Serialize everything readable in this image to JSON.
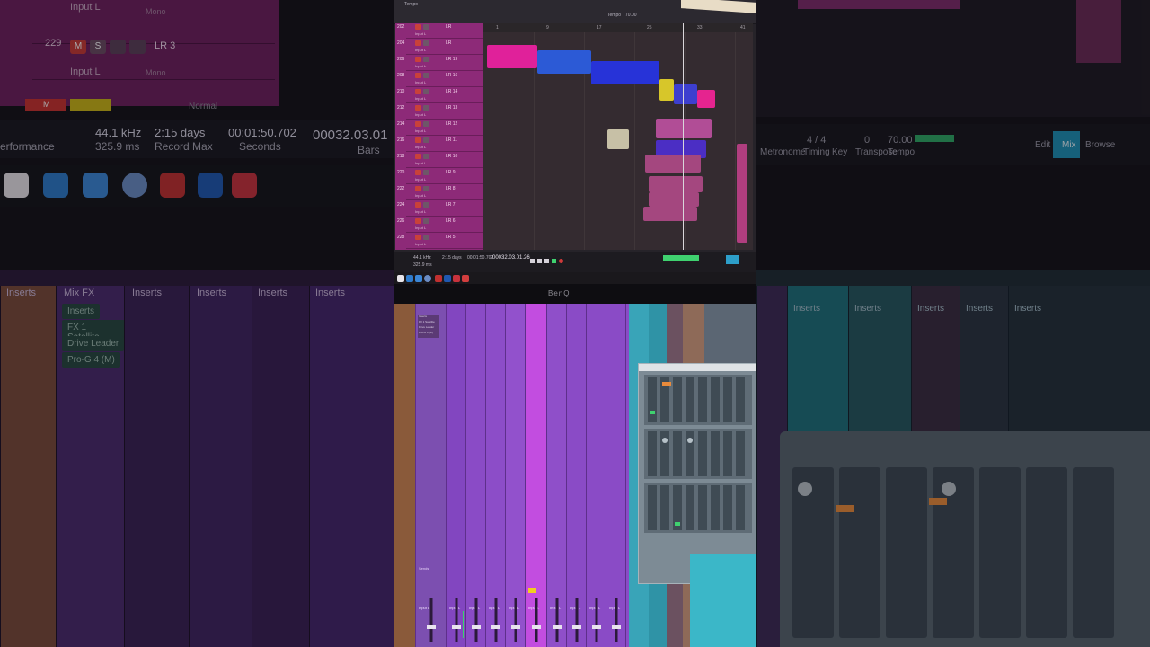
{
  "left_blur": {
    "tracks": [
      {
        "number": "",
        "input": "Input L",
        "mode": "Mono"
      },
      {
        "number": "229",
        "input": "Input L",
        "mode": "Mono",
        "label": "LR 3",
        "mute": "M",
        "solo": "S"
      }
    ],
    "color_bar_label": "M",
    "mode_label": "Normal",
    "status": {
      "perf_label": "erformance",
      "sample_rate": "44.1 kHz",
      "latency": "325.9 ms",
      "record_max_value": "2:15 days",
      "record_max_label": "Record Max",
      "time": "00:01:50.702",
      "time_unit": "Seconds",
      "position": "00032.03.01",
      "position_unit": "Bars"
    },
    "mixer_headers": [
      "Inserts",
      "Mix FX",
      "Inserts",
      "Inserts",
      "Inserts",
      "Inserts"
    ],
    "mix_fx_inserts": [
      "Inserts",
      "FX 1 Satellite",
      "Drive Leader",
      "Pro-G 4 (M)"
    ]
  },
  "right_blur": {
    "status": {
      "label_a": "Metronome",
      "label_b": "Timing",
      "label_c": "Key",
      "label_d": "Transpose",
      "label_e": "Tempo",
      "tempo": "70.00",
      "timing": "4 / 4",
      "transpose": "0",
      "edit_label": "Edit",
      "mix_label": "Mix",
      "browse_label": "Browse"
    },
    "mixer_headers": [
      "Inserts",
      "Inserts",
      "Inserts",
      "Inserts",
      "Inserts"
    ]
  },
  "center": {
    "toolbar": {
      "tempo_label": "Tempo",
      "tempo_value": "70.00"
    },
    "ruler": [
      "1",
      "9",
      "17",
      "25",
      "33",
      "41"
    ],
    "tracks": [
      {
        "number": "202",
        "lr": "LR",
        "input": "Input L"
      },
      {
        "number": "204",
        "lr": "LR",
        "input": "Input L"
      },
      {
        "number": "206",
        "lr": "LR 19",
        "input": "Input L"
      },
      {
        "number": "208",
        "lr": "LR 16",
        "input": "Input L"
      },
      {
        "number": "210",
        "lr": "LR 14",
        "input": "Input L"
      },
      {
        "number": "212",
        "lr": "LR 13",
        "input": "Input L"
      },
      {
        "number": "214",
        "lr": "LR 12",
        "input": "Input L"
      },
      {
        "number": "216",
        "lr": "LR 11",
        "input": "Input L"
      },
      {
        "number": "218",
        "lr": "LR 10",
        "input": "Input L"
      },
      {
        "number": "220",
        "lr": "LR 9",
        "input": "Input L"
      },
      {
        "number": "222",
        "lr": "LR 8",
        "input": "Input L"
      },
      {
        "number": "224",
        "lr": "LR 7",
        "input": "Input L"
      },
      {
        "number": "226",
        "lr": "LR 6",
        "input": "Input L"
      },
      {
        "number": "228",
        "lr": "LR 5",
        "input": "Input L"
      }
    ],
    "status": {
      "sample_rate": "44.1 kHz",
      "latency": "325.9 ms",
      "record_max": "2:15 days",
      "time": "00:01:50.702",
      "position": "00032.03.01.26",
      "mode": "Normal"
    },
    "monitor_brand": "BenQ",
    "mixer": {
      "fx_items": [
        "Inserts",
        "FX 1 Satellite",
        "Drive Leader",
        "Pro-G 4 (M)"
      ],
      "send_label": "Sends",
      "strip_names": [
        "Input L",
        "Input L",
        "Input L",
        "Input L",
        "Input L",
        "Input L",
        "Input L",
        "Input L",
        "Input L",
        "Input L",
        "Input L",
        "Input L",
        "Input L",
        "Input L",
        "Input L"
      ]
    },
    "colors": {
      "magenta": "#c2218f",
      "blue": "#2a4fd8",
      "purple_mixer": "#8a4bc6",
      "cyan": "#39a4b8",
      "yellow": "#e4cf22"
    }
  }
}
